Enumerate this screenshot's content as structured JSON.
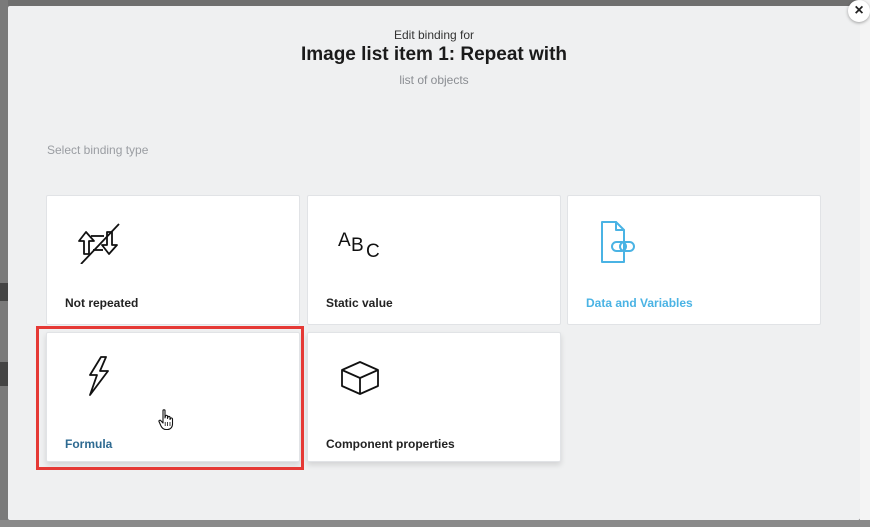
{
  "dialog": {
    "close_glyph": "×",
    "heading_small": "Edit binding for",
    "heading": "Image list item 1: Repeat with",
    "heading_sub": "list of objects",
    "section_label": "Select binding type"
  },
  "binding_types": [
    {
      "label": "Not repeated",
      "icon": "not-repeated-icon"
    },
    {
      "label": "Static value",
      "icon": "abc-icon"
    },
    {
      "label": "Data and Variables",
      "icon": "data-link-icon",
      "color": "#4ab3e4"
    },
    {
      "label": "Formula",
      "icon": "lightning-icon",
      "color": "#2e6a91"
    },
    {
      "label": "Component properties",
      "icon": "cube-icon"
    }
  ],
  "icon_text": {
    "a": "A",
    "b": "B",
    "c": "C"
  },
  "colors": {
    "highlight": "#e53935",
    "accent": "#4ab3e4"
  }
}
